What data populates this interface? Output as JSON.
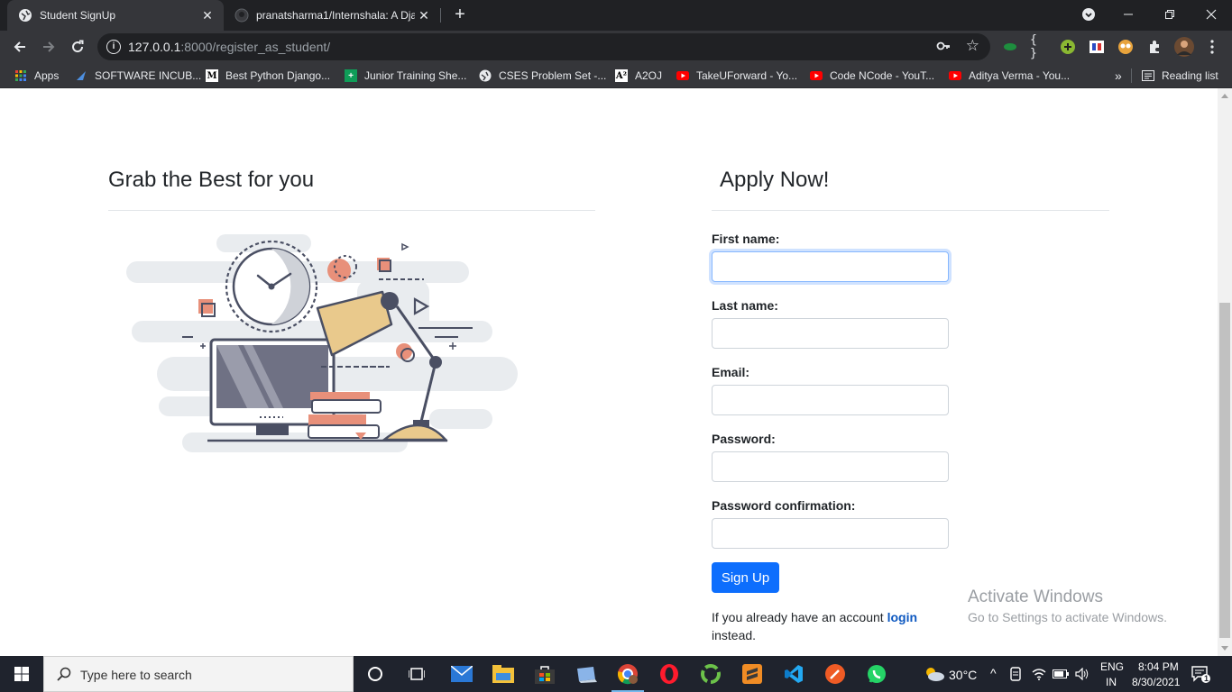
{
  "browser": {
    "tabs": [
      {
        "title": "Student SignUp",
        "active": true
      },
      {
        "title": "pranatsharma1/Internshala: A Dja",
        "active": false
      }
    ],
    "url_host": "127.0.0.1",
    "url_path": ":8000/register_as_student/",
    "bookmarks": [
      {
        "label": "Apps",
        "icon": "apps-grid-icon"
      },
      {
        "label": "SOFTWARE INCUB...",
        "icon": "software-incubator-icon"
      },
      {
        "label": "Best Python Django...",
        "icon": "medium-icon"
      },
      {
        "label": "Junior Training She...",
        "icon": "sheets-icon"
      },
      {
        "label": "CSES Problem Set -...",
        "icon": "cses-icon"
      },
      {
        "label": "A2OJ",
        "icon": "a2oj-icon"
      },
      {
        "label": "TakeUForward - Yo...",
        "icon": "youtube-icon"
      },
      {
        "label": "Code NCode - YouT...",
        "icon": "youtube-icon"
      },
      {
        "label": "Aditya Verma - You...",
        "icon": "youtube-icon"
      }
    ],
    "bookmarks_overflow": "»",
    "reading_list": "Reading list"
  },
  "page": {
    "left_heading": "Grab the Best for you",
    "right_heading": "Apply Now!",
    "form": {
      "first_name_label": "First name:",
      "last_name_label": "Last name:",
      "email_label": "Email:",
      "password_label": "Password:",
      "password_confirm_label": "Password confirmation:",
      "first_name_value": "",
      "last_name_value": "",
      "email_value": "",
      "password_value": "",
      "password_confirm_value": "",
      "submit_label": "Sign Up"
    },
    "login_prefix": "If you already have an account ",
    "login_link": "login",
    "login_suffix": "instead."
  },
  "watermark": {
    "title": "Activate Windows",
    "subtitle": "Go to Settings to activate Windows."
  },
  "taskbar": {
    "search_placeholder": "Type here to search",
    "weather": "30°C",
    "language_top": "ENG",
    "language_bottom": "IN",
    "time": "8:04 PM",
    "date": "8/30/2021",
    "notification_count": "1"
  },
  "colors": {
    "accent_blue": "#0d6efd",
    "login_link": "#0d58c0",
    "illustration_salmon": "#e8907a",
    "illustration_tan": "#e9c98c",
    "illustration_dark": "#4a4f63"
  }
}
